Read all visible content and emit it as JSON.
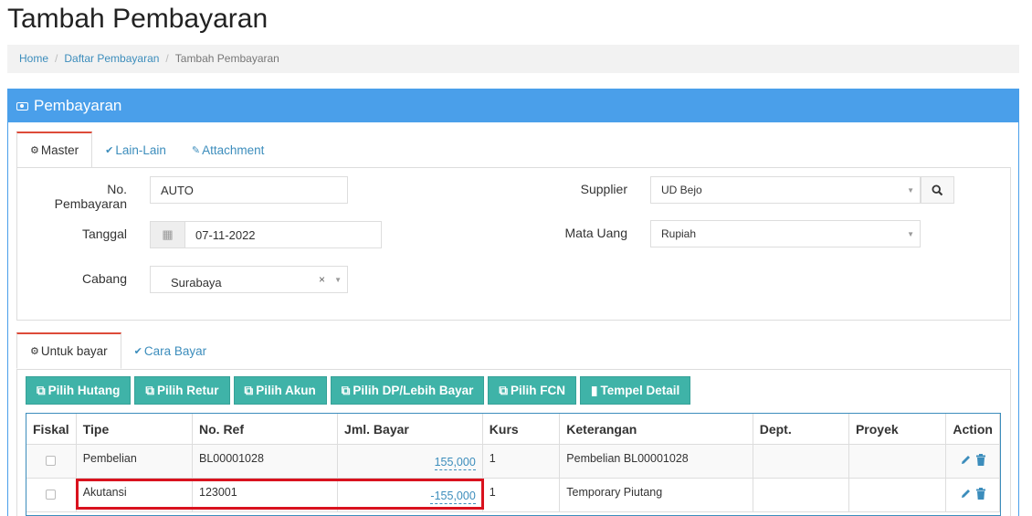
{
  "page": {
    "title": "Tambah Pembayaran"
  },
  "breadcrumb": {
    "home": "Home",
    "list": "Daftar Pembayaran",
    "current": "Tambah Pembayaran"
  },
  "panel": {
    "title": "Pembayaran"
  },
  "top_tabs": [
    {
      "label": "Master",
      "icon": "gears-icon",
      "active": true
    },
    {
      "label": "Lain-Lain",
      "icon": "check-circle-icon",
      "active": false
    },
    {
      "label": "Attachment",
      "icon": "paperclip-icon",
      "active": false
    }
  ],
  "form": {
    "no_pembayaran": {
      "label": "No. Pembayaran",
      "value": "AUTO"
    },
    "tanggal": {
      "label": "Tanggal",
      "value": "07-11-2022"
    },
    "cabang": {
      "label": "Cabang",
      "value": "Surabaya"
    },
    "supplier": {
      "label": "Supplier",
      "value": "UD Bejo"
    },
    "mata_uang": {
      "label": "Mata Uang",
      "value": "Rupiah"
    }
  },
  "detail_tabs": [
    {
      "label": "Untuk bayar",
      "icon": "gears-icon",
      "active": true
    },
    {
      "label": "Cara Bayar",
      "icon": "check-circle-icon",
      "active": false
    }
  ],
  "buttons": [
    {
      "label": "Pilih Hutang",
      "icon": "copy-icon"
    },
    {
      "label": "Pilih Retur",
      "icon": "copy-icon"
    },
    {
      "label": "Pilih Akun",
      "icon": "copy-icon"
    },
    {
      "label": "Pilih DP/Lebih Bayar",
      "icon": "copy-icon"
    },
    {
      "label": "Pilih FCN",
      "icon": "copy-icon"
    },
    {
      "label": "Tempel Detail",
      "icon": "paste-icon"
    }
  ],
  "table": {
    "columns": [
      "Fiskal",
      "Tipe",
      "No. Ref",
      "Jml. Bayar",
      "Kurs",
      "Keterangan",
      "Dept.",
      "Proyek",
      "Action"
    ],
    "rows": [
      {
        "tipe": "Pembelian",
        "no_ref": "BL00001028",
        "jml_bayar": "155,000",
        "kurs": "1",
        "keterangan": "Pembelian BL00001028",
        "dept": "",
        "proyek": ""
      },
      {
        "tipe": "Akutansi",
        "no_ref": "123001",
        "jml_bayar": "-155,000",
        "kurs": "1",
        "keterangan": "Temporary Piutang",
        "dept": "",
        "proyek": ""
      }
    ]
  },
  "colors": {
    "primary": "#4a9fea",
    "link": "#3c8dbc",
    "button": "#3fb3a8",
    "tab_active_border": "#dd4b39",
    "highlight": "#d9121e"
  }
}
